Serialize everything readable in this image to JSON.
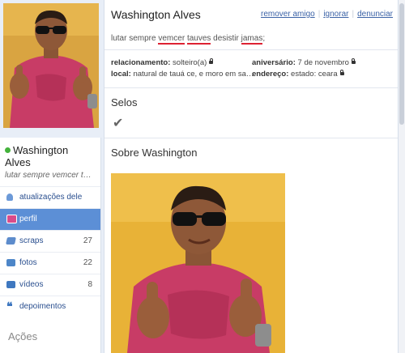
{
  "profile": {
    "name": "Washington Alves",
    "name_line1": "Washington",
    "name_line2": "Alves",
    "status_short": "lutar sempre vemcer tauv…",
    "status_parts": [
      "lutar sempre ",
      "vemcer",
      " ",
      "tauves",
      " desistir ",
      "jamas",
      ";"
    ],
    "actions": {
      "remove": "remover amigo",
      "ignore": "ignorar",
      "report": "denunciar"
    },
    "info": {
      "relacionamento_label": "relacionamento:",
      "relacionamento_value": "solteiro(a)",
      "aniversario_label": "aniversário:",
      "aniversario_value": "7 de novembro",
      "local_label": "local:",
      "local_value": "natural de tauá ce, e moro em sa…",
      "endereco_label": "endereço:",
      "endereco_value": "estado: ceara"
    }
  },
  "nav": {
    "items": [
      {
        "label": "atualizações dele",
        "count": "",
        "icon": "updates-icon"
      },
      {
        "label": "perfil",
        "count": "",
        "icon": "profile-icon"
      },
      {
        "label": "scraps",
        "count": "27",
        "icon": "scraps-icon"
      },
      {
        "label": "fotos",
        "count": "22",
        "icon": "camera-icon"
      },
      {
        "label": "vídeos",
        "count": "8",
        "icon": "video-icon"
      },
      {
        "label": "depoimentos",
        "count": "",
        "icon": "quote-icon"
      }
    ],
    "active": "perfil",
    "acoes_title": "Ações"
  },
  "sections": {
    "selos": "Selos",
    "sobre": "Sobre Washington"
  },
  "colors": {
    "accent": "#5c8fd6",
    "link": "#3b62a6",
    "online": "#44b23c",
    "photo_bg": "#e8b237",
    "shirt": "#c83c66"
  }
}
